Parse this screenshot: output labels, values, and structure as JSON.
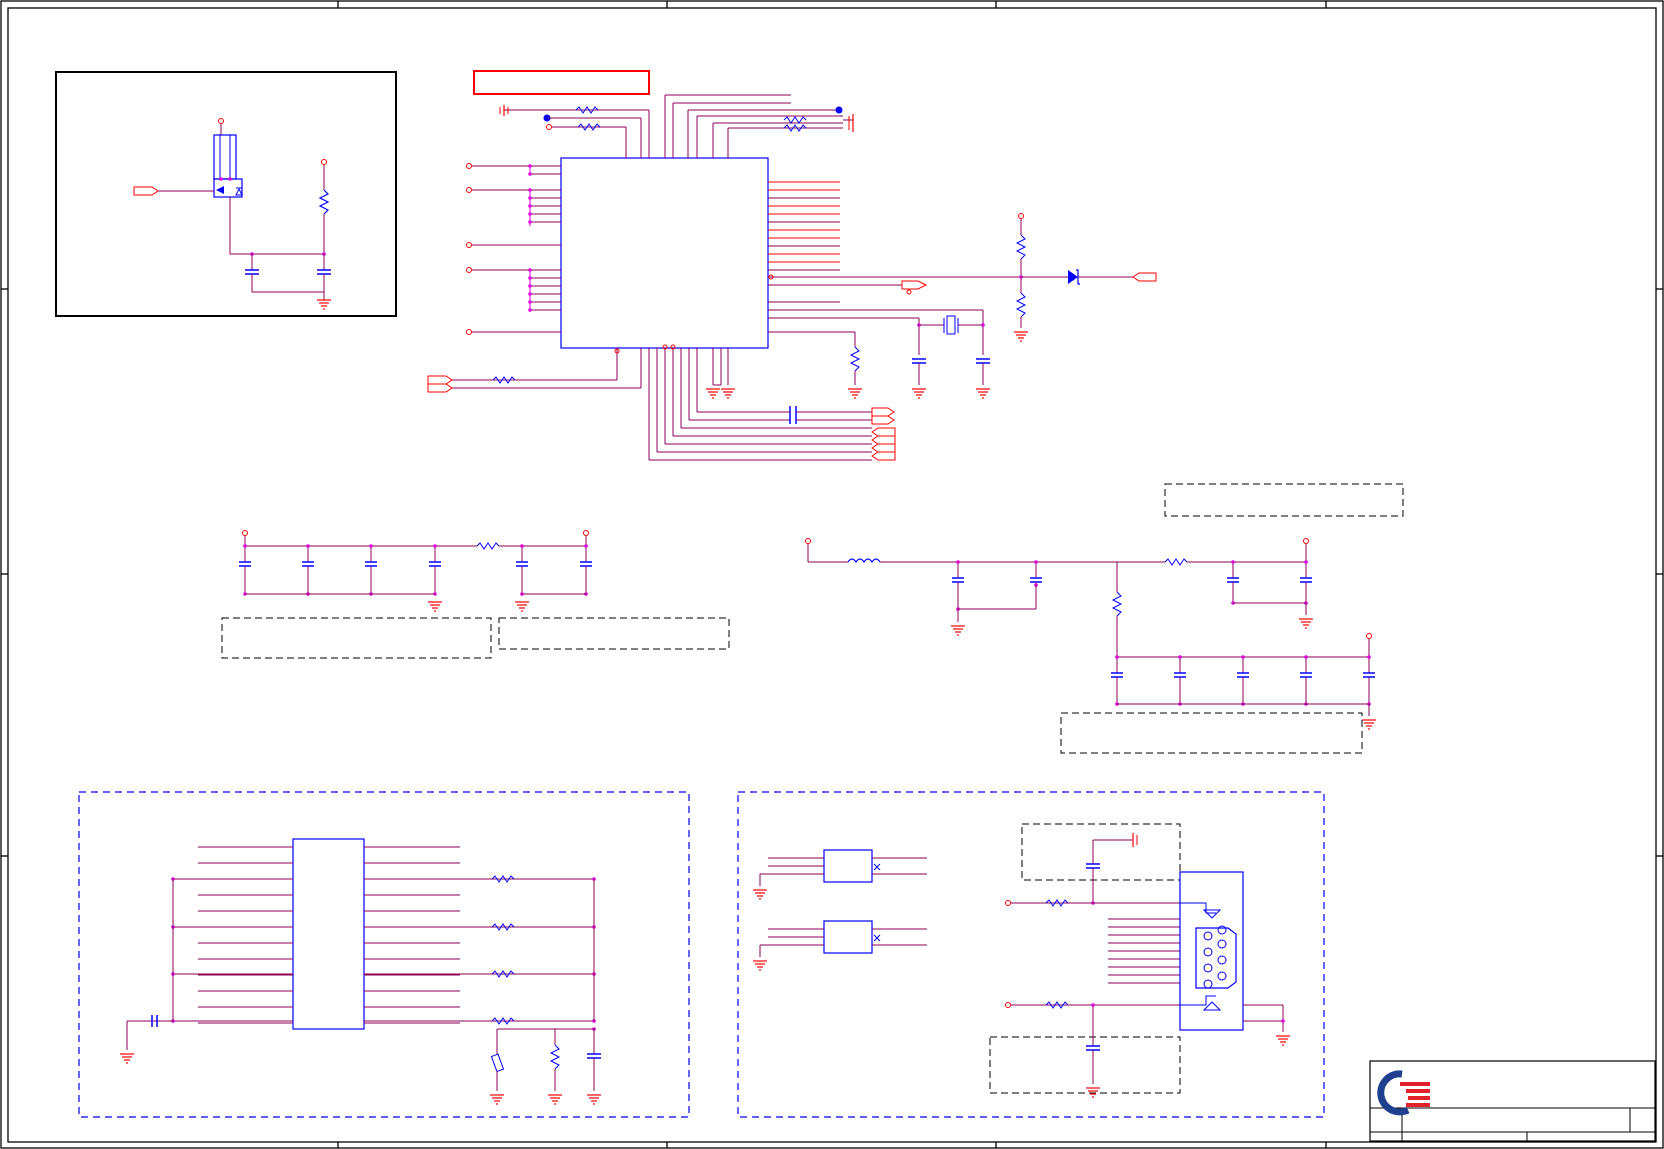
{
  "document": {
    "type": "electrical-schematic-sheet",
    "text": [],
    "colors": {
      "wire": "#8b0057",
      "net": "#ff0000",
      "component": "#0000ff",
      "junction": "#dd00dd",
      "frame": "#000000",
      "note_box": "#000000",
      "section_box": "#0000ff",
      "highlight_box": "#ff0000",
      "logo_blue": "#1f3f8f",
      "logo_red": "#e0202a"
    }
  },
  "sections": {
    "power_switch": {
      "label": ""
    },
    "main_ic": {
      "label": ""
    },
    "decoupling_left": {
      "label": ""
    },
    "decoupling_right": {
      "label": ""
    },
    "buffer_block": {
      "label": ""
    },
    "connector_block": {
      "label": ""
    },
    "title_block": {
      "title": "",
      "doc_number": "",
      "rev": "",
      "sheet": ""
    }
  },
  "icons": [
    "company-logo-icon",
    "ground-icon",
    "power-pin-icon",
    "crystal-icon",
    "diode-icon",
    "db9-connector-icon"
  ]
}
